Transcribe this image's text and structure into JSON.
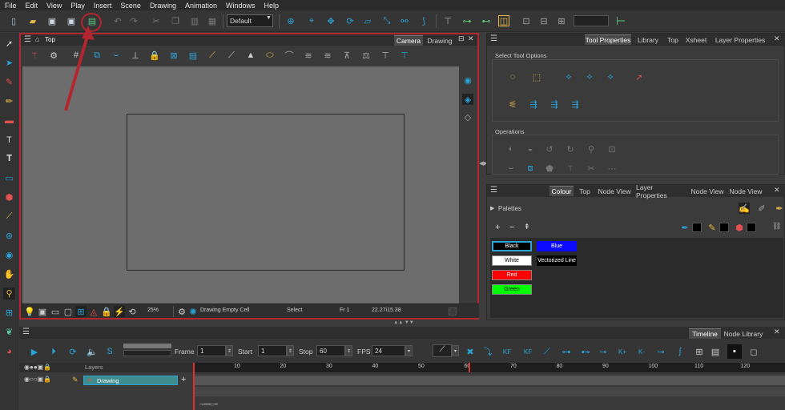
{
  "menu": [
    "File",
    "Edit",
    "View",
    "Play",
    "Insert",
    "Scene",
    "Drawing",
    "Animation",
    "Windows",
    "Help"
  ],
  "toolbar": {
    "workspace_value": "Default"
  },
  "viewport": {
    "title": "Top",
    "tabs": [
      "Camera",
      "Drawing"
    ]
  },
  "status": {
    "zoom": "25%",
    "drawing": "Drawing Empty Cell",
    "tool": "Select",
    "frame": "Fr 1",
    "coords": "22.27i15.38"
  },
  "tool_properties": {
    "tabs": [
      "Tool Properties",
      "Library",
      "Top",
      "Xsheet",
      "Layer Properties"
    ],
    "section_select": "Select Tool Options",
    "section_operations": "Operations"
  },
  "colour": {
    "tabs": [
      "Colour",
      "Top",
      "Node View",
      "Layer Properties",
      "Node View",
      "Node View"
    ],
    "palettes_label": "Palettes",
    "swatches": [
      {
        "name": "Black",
        "color": "#000000",
        "text": "#ffffff"
      },
      {
        "name": "Blue",
        "color": "#0a0aff",
        "text": "#ffffff"
      },
      {
        "name": "White",
        "color": "#ffffff",
        "text": "#000000"
      },
      {
        "name": "Vectorized Line",
        "color": "#000000",
        "text": "#ffffff"
      },
      {
        "name": "Red",
        "color": "#ff0000",
        "text": "#ffffff"
      },
      {
        "name": "Green",
        "color": "#00ff00",
        "text": "#000000"
      }
    ]
  },
  "timeline": {
    "tabs": [
      "Timeline",
      "Node Library"
    ],
    "frame_label": "Frame",
    "frame_value": "1",
    "start_label": "Start",
    "start_value": "1",
    "stop_label": "Stop",
    "stop_value": "60",
    "fps_label": "FPS",
    "fps_value": "24",
    "layers_header": "Layers",
    "layer_name": "Drawing",
    "ticks": [
      "10",
      "20",
      "30",
      "40",
      "50",
      "60",
      "70",
      "80",
      "90",
      "100",
      "110",
      "120"
    ]
  },
  "colors": {
    "accent": "#2aa3d8",
    "highlight": "#b3262f"
  }
}
